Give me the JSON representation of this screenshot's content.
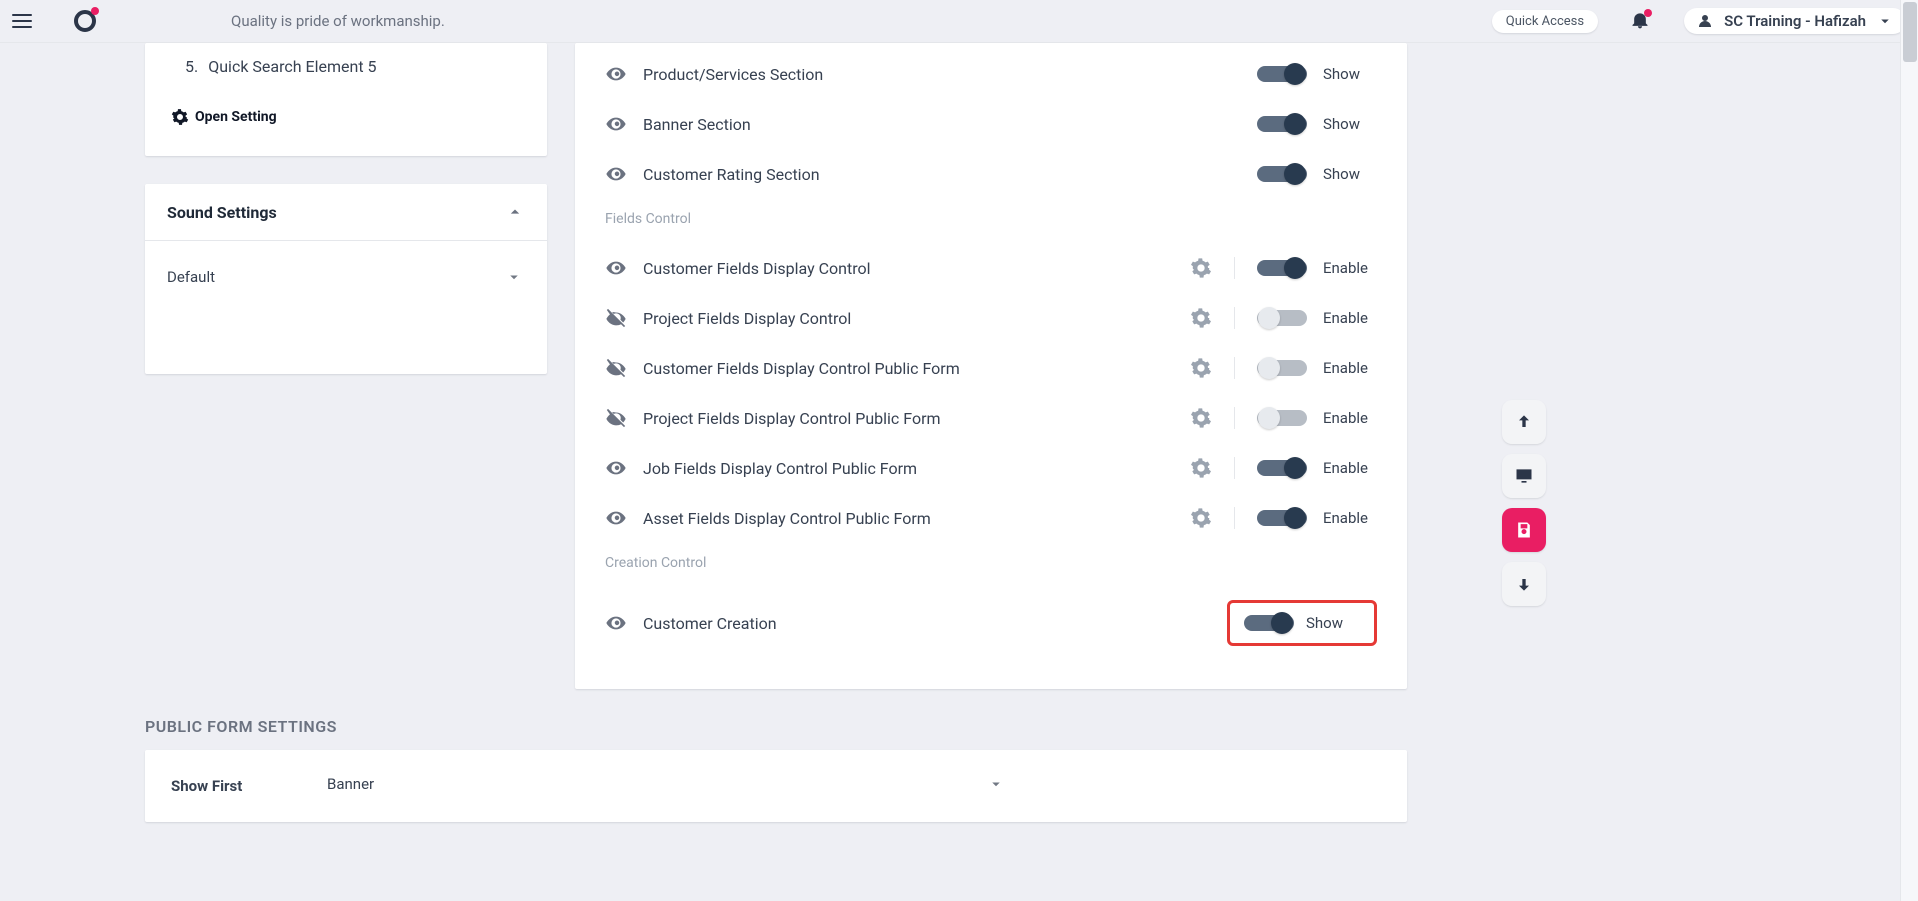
{
  "header": {
    "tagline": "Quality is pride of workmanship.",
    "quick_access": "Quick Access",
    "user_name": "SC Training - Hafizah"
  },
  "left": {
    "quick_search_item5_idx": "5.",
    "quick_search_item5_label": "Quick Search Element 5",
    "open_setting": "Open Setting",
    "sound_settings_title": "Sound Settings",
    "sound_default": "Default"
  },
  "main": {
    "sections_rows": [
      {
        "label": "Product/Services Section",
        "on": true,
        "visible": true,
        "toggle_text": "Show"
      },
      {
        "label": "Banner Section",
        "on": true,
        "visible": true,
        "toggle_text": "Show"
      },
      {
        "label": "Customer Rating Section",
        "on": true,
        "visible": true,
        "toggle_text": "Show"
      }
    ],
    "fields_control_title": "Fields Control",
    "fields_rows": [
      {
        "label": "Customer Fields Display Control",
        "on": true,
        "visible": true,
        "has_gear": true,
        "toggle_text": "Enable"
      },
      {
        "label": "Project Fields Display Control",
        "on": false,
        "visible": false,
        "has_gear": true,
        "toggle_text": "Enable"
      },
      {
        "label": "Customer Fields Display Control Public Form",
        "on": false,
        "visible": false,
        "has_gear": true,
        "toggle_text": "Enable"
      },
      {
        "label": "Project Fields Display Control Public Form",
        "on": false,
        "visible": false,
        "has_gear": true,
        "toggle_text": "Enable"
      },
      {
        "label": "Job Fields Display Control Public Form",
        "on": true,
        "visible": true,
        "has_gear": true,
        "toggle_text": "Enable"
      },
      {
        "label": "Asset Fields Display Control Public Form",
        "on": true,
        "visible": true,
        "has_gear": true,
        "toggle_text": "Enable"
      }
    ],
    "creation_control_title": "Creation Control",
    "creation_rows": [
      {
        "label": "Customer Creation",
        "on": true,
        "visible": true,
        "toggle_text": "Show",
        "highlight": true
      }
    ]
  },
  "public_form": {
    "heading": "PUBLIC FORM SETTINGS",
    "show_first_label": "Show First",
    "show_first_value": "Banner"
  }
}
